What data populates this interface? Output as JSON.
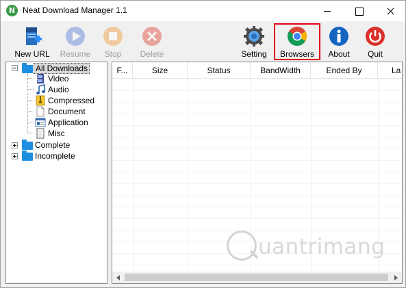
{
  "window": {
    "title": "Neat Download Manager 1.1",
    "app_icon_letter": "N"
  },
  "toolbar": {
    "new_url": "New URL",
    "resume": "Resume",
    "stop": "Stop",
    "delete": "Delete",
    "setting": "Setting",
    "browsers": "Browsers",
    "about": "About",
    "quit": "Quit"
  },
  "tree": {
    "all_downloads": "All Downloads",
    "video": "Video",
    "audio": "Audio",
    "compressed": "Compressed",
    "document": "Document",
    "application": "Application",
    "misc": "Misc",
    "complete": "Complete",
    "incomplete": "Incomplete"
  },
  "list": {
    "columns": [
      "F...",
      "Size",
      "Status",
      "BandWidth",
      "Ended By",
      "La"
    ]
  },
  "watermark": {
    "text": "uantrimang"
  },
  "colors": {
    "highlight_border": "#e3001b",
    "folder_blue": "#1e8fe0",
    "quit_red": "#d9302a",
    "about_blue": "#1565c0"
  }
}
